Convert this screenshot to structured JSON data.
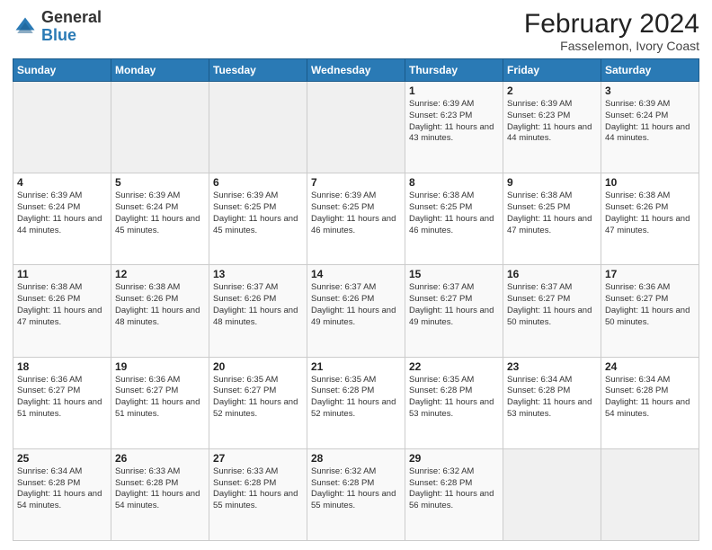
{
  "logo": {
    "general": "General",
    "blue": "Blue"
  },
  "header": {
    "month": "February 2024",
    "location": "Fasselemon, Ivory Coast"
  },
  "weekdays": [
    "Sunday",
    "Monday",
    "Tuesday",
    "Wednesday",
    "Thursday",
    "Friday",
    "Saturday"
  ],
  "weeks": [
    [
      {
        "day": "",
        "sunrise": "",
        "sunset": "",
        "daylight": ""
      },
      {
        "day": "",
        "sunrise": "",
        "sunset": "",
        "daylight": ""
      },
      {
        "day": "",
        "sunrise": "",
        "sunset": "",
        "daylight": ""
      },
      {
        "day": "",
        "sunrise": "",
        "sunset": "",
        "daylight": ""
      },
      {
        "day": "1",
        "sunrise": "Sunrise: 6:39 AM",
        "sunset": "Sunset: 6:23 PM",
        "daylight": "Daylight: 11 hours and 43 minutes."
      },
      {
        "day": "2",
        "sunrise": "Sunrise: 6:39 AM",
        "sunset": "Sunset: 6:23 PM",
        "daylight": "Daylight: 11 hours and 44 minutes."
      },
      {
        "day": "3",
        "sunrise": "Sunrise: 6:39 AM",
        "sunset": "Sunset: 6:24 PM",
        "daylight": "Daylight: 11 hours and 44 minutes."
      }
    ],
    [
      {
        "day": "4",
        "sunrise": "Sunrise: 6:39 AM",
        "sunset": "Sunset: 6:24 PM",
        "daylight": "Daylight: 11 hours and 44 minutes."
      },
      {
        "day": "5",
        "sunrise": "Sunrise: 6:39 AM",
        "sunset": "Sunset: 6:24 PM",
        "daylight": "Daylight: 11 hours and 45 minutes."
      },
      {
        "day": "6",
        "sunrise": "Sunrise: 6:39 AM",
        "sunset": "Sunset: 6:25 PM",
        "daylight": "Daylight: 11 hours and 45 minutes."
      },
      {
        "day": "7",
        "sunrise": "Sunrise: 6:39 AM",
        "sunset": "Sunset: 6:25 PM",
        "daylight": "Daylight: 11 hours and 46 minutes."
      },
      {
        "day": "8",
        "sunrise": "Sunrise: 6:38 AM",
        "sunset": "Sunset: 6:25 PM",
        "daylight": "Daylight: 11 hours and 46 minutes."
      },
      {
        "day": "9",
        "sunrise": "Sunrise: 6:38 AM",
        "sunset": "Sunset: 6:25 PM",
        "daylight": "Daylight: 11 hours and 47 minutes."
      },
      {
        "day": "10",
        "sunrise": "Sunrise: 6:38 AM",
        "sunset": "Sunset: 6:26 PM",
        "daylight": "Daylight: 11 hours and 47 minutes."
      }
    ],
    [
      {
        "day": "11",
        "sunrise": "Sunrise: 6:38 AM",
        "sunset": "Sunset: 6:26 PM",
        "daylight": "Daylight: 11 hours and 47 minutes."
      },
      {
        "day": "12",
        "sunrise": "Sunrise: 6:38 AM",
        "sunset": "Sunset: 6:26 PM",
        "daylight": "Daylight: 11 hours and 48 minutes."
      },
      {
        "day": "13",
        "sunrise": "Sunrise: 6:37 AM",
        "sunset": "Sunset: 6:26 PM",
        "daylight": "Daylight: 11 hours and 48 minutes."
      },
      {
        "day": "14",
        "sunrise": "Sunrise: 6:37 AM",
        "sunset": "Sunset: 6:26 PM",
        "daylight": "Daylight: 11 hours and 49 minutes."
      },
      {
        "day": "15",
        "sunrise": "Sunrise: 6:37 AM",
        "sunset": "Sunset: 6:27 PM",
        "daylight": "Daylight: 11 hours and 49 minutes."
      },
      {
        "day": "16",
        "sunrise": "Sunrise: 6:37 AM",
        "sunset": "Sunset: 6:27 PM",
        "daylight": "Daylight: 11 hours and 50 minutes."
      },
      {
        "day": "17",
        "sunrise": "Sunrise: 6:36 AM",
        "sunset": "Sunset: 6:27 PM",
        "daylight": "Daylight: 11 hours and 50 minutes."
      }
    ],
    [
      {
        "day": "18",
        "sunrise": "Sunrise: 6:36 AM",
        "sunset": "Sunset: 6:27 PM",
        "daylight": "Daylight: 11 hours and 51 minutes."
      },
      {
        "day": "19",
        "sunrise": "Sunrise: 6:36 AM",
        "sunset": "Sunset: 6:27 PM",
        "daylight": "Daylight: 11 hours and 51 minutes."
      },
      {
        "day": "20",
        "sunrise": "Sunrise: 6:35 AM",
        "sunset": "Sunset: 6:27 PM",
        "daylight": "Daylight: 11 hours and 52 minutes."
      },
      {
        "day": "21",
        "sunrise": "Sunrise: 6:35 AM",
        "sunset": "Sunset: 6:28 PM",
        "daylight": "Daylight: 11 hours and 52 minutes."
      },
      {
        "day": "22",
        "sunrise": "Sunrise: 6:35 AM",
        "sunset": "Sunset: 6:28 PM",
        "daylight": "Daylight: 11 hours and 53 minutes."
      },
      {
        "day": "23",
        "sunrise": "Sunrise: 6:34 AM",
        "sunset": "Sunset: 6:28 PM",
        "daylight": "Daylight: 11 hours and 53 minutes."
      },
      {
        "day": "24",
        "sunrise": "Sunrise: 6:34 AM",
        "sunset": "Sunset: 6:28 PM",
        "daylight": "Daylight: 11 hours and 54 minutes."
      }
    ],
    [
      {
        "day": "25",
        "sunrise": "Sunrise: 6:34 AM",
        "sunset": "Sunset: 6:28 PM",
        "daylight": "Daylight: 11 hours and 54 minutes."
      },
      {
        "day": "26",
        "sunrise": "Sunrise: 6:33 AM",
        "sunset": "Sunset: 6:28 PM",
        "daylight": "Daylight: 11 hours and 54 minutes."
      },
      {
        "day": "27",
        "sunrise": "Sunrise: 6:33 AM",
        "sunset": "Sunset: 6:28 PM",
        "daylight": "Daylight: 11 hours and 55 minutes."
      },
      {
        "day": "28",
        "sunrise": "Sunrise: 6:32 AM",
        "sunset": "Sunset: 6:28 PM",
        "daylight": "Daylight: 11 hours and 55 minutes."
      },
      {
        "day": "29",
        "sunrise": "Sunrise: 6:32 AM",
        "sunset": "Sunset: 6:28 PM",
        "daylight": "Daylight: 11 hours and 56 minutes."
      },
      {
        "day": "",
        "sunrise": "",
        "sunset": "",
        "daylight": ""
      },
      {
        "day": "",
        "sunrise": "",
        "sunset": "",
        "daylight": ""
      }
    ]
  ]
}
